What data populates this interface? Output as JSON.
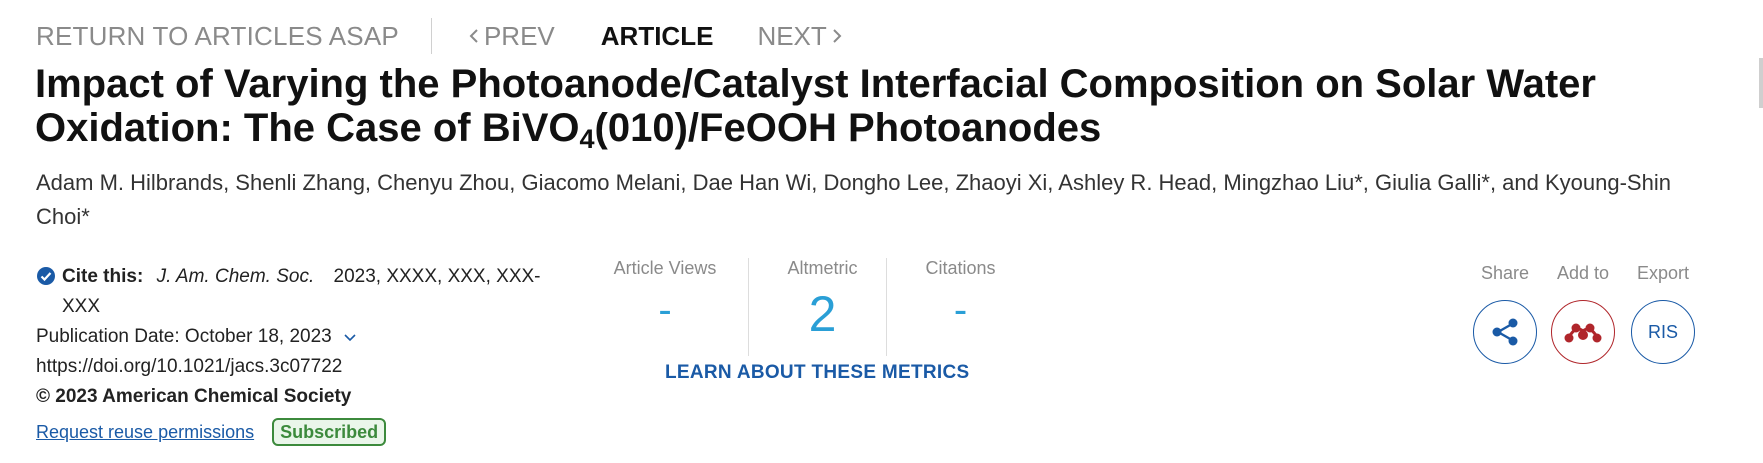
{
  "nav": {
    "return_label": "RETURN TO ARTICLES ASAP",
    "prev_label": "PREV",
    "article_label": "ARTICLE",
    "next_label": "NEXT"
  },
  "title": {
    "part1": "Impact of Varying the Photoanode/Catalyst Interfacial Composition on Solar Water Oxidation: The Case of BiVO",
    "sub": "4",
    "part2": "(010)/FeOOH Photoanodes"
  },
  "authors": "Adam M. Hilbrands, Shenli Zhang, Chenyu Zhou, Giacomo Melani, Dae Han Wi, Dongho Lee, Zhaoyi Xi, Ashley R. Head, Mingzhao Liu*, Giulia Galli*, and Kyoung-Shin Choi*",
  "meta": {
    "cite_label": "Cite this:",
    "journal": "J. Am. Chem. Soc.",
    "citation": "2023, XXXX, XXX, XXX-XXX",
    "publication_date": "Publication Date: October 18, 2023",
    "doi": "https://doi.org/10.1021/jacs.3c07722",
    "copyright": "© 2023 American Chemical Society",
    "reuse_label": "Request reuse permissions",
    "badge": "Subscribed"
  },
  "metrics": {
    "views_label": "Article Views",
    "views_value": "-",
    "altmetric_label": "Altmetric",
    "altmetric_value": "2",
    "citations_label": "Citations",
    "citations_value": "-",
    "learn_label": "LEARN ABOUT THESE METRICS"
  },
  "actions": {
    "share_label": "Share",
    "add_label": "Add to",
    "export_label": "Export",
    "export_button": "RIS"
  },
  "colors": {
    "link": "#1a5aa6",
    "metric": "#2a9fd6",
    "badge_green": "#3c8a3c",
    "mendeley_red": "#b0262b"
  }
}
